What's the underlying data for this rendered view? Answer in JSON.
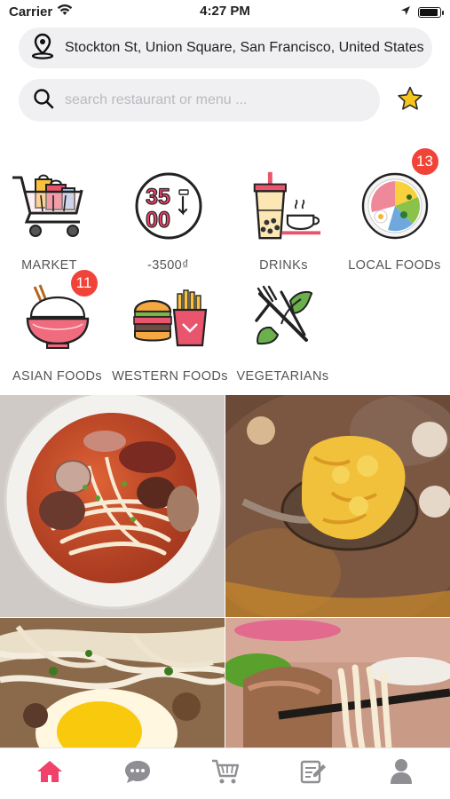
{
  "status_bar": {
    "carrier": "Carrier",
    "time": "4:27 PM",
    "battery_level": 0.9
  },
  "location": {
    "address": "Stockton St, Union Square, San Francisco, United States"
  },
  "search": {
    "placeholder": "search restaurant or menu ...",
    "value": ""
  },
  "categories": [
    {
      "label": "MARKET",
      "icon": "shopping-cart-icon",
      "badge": ""
    },
    {
      "label": "-3500₫",
      "icon": "price-tag-icon",
      "icon_text_top": "35",
      "icon_text_bottom": "00",
      "badge": ""
    },
    {
      "label": "DRINKs",
      "icon": "bubble-tea-icon",
      "badge": ""
    },
    {
      "label": "LOCAL FOODs",
      "icon": "salad-plate-icon",
      "badge": "13"
    },
    {
      "label": "ASIAN FOODs",
      "icon": "rice-bowl-icon",
      "badge": "11"
    },
    {
      "label": "WESTERN FOODs",
      "icon": "burger-fries-icon",
      "badge": ""
    },
    {
      "label": "VEGETARIANs",
      "icon": "vegetarian-icon",
      "badge": ""
    }
  ],
  "photos": [
    {
      "name": "noodle-soup-photo"
    },
    {
      "name": "fried-tofu-hotpot-photo"
    },
    {
      "name": "noodles-egg-photo"
    },
    {
      "name": "noodles-chopsticks-photo"
    }
  ],
  "tab_bar": [
    {
      "name": "tab-home",
      "icon": "home-icon",
      "active": true
    },
    {
      "name": "tab-chat",
      "icon": "chat-icon",
      "active": false
    },
    {
      "name": "tab-cart",
      "icon": "cart-icon",
      "active": false
    },
    {
      "name": "tab-orders",
      "icon": "orders-icon",
      "active": false
    },
    {
      "name": "tab-profile",
      "icon": "profile-icon",
      "active": false
    }
  ],
  "colors": {
    "accent": "#f0426b",
    "badge": "#f04438",
    "inactive_tab": "#8e8e93",
    "pill_bg": "#f0f0f2"
  }
}
